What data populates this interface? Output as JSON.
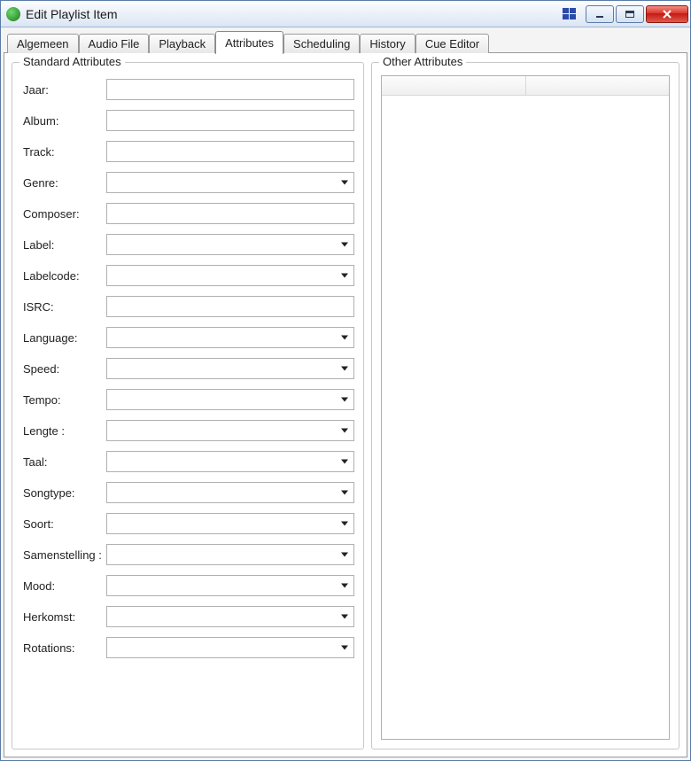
{
  "window": {
    "title": "Edit Playlist Item"
  },
  "tabs": [
    {
      "label": "Algemeen",
      "active": false
    },
    {
      "label": "Audio File",
      "active": false
    },
    {
      "label": "Playback",
      "active": false
    },
    {
      "label": "Attributes",
      "active": true
    },
    {
      "label": "Scheduling",
      "active": false
    },
    {
      "label": "History",
      "active": false
    },
    {
      "label": "Cue Editor",
      "active": false
    }
  ],
  "groups": {
    "standard": {
      "title": "Standard Attributes"
    },
    "other": {
      "title": "Other Attributes"
    }
  },
  "fields": [
    {
      "key": "jaar",
      "label": "Jaar:",
      "type": "text",
      "value": ""
    },
    {
      "key": "album",
      "label": "Album:",
      "type": "text",
      "value": ""
    },
    {
      "key": "track",
      "label": "Track:",
      "type": "text",
      "value": ""
    },
    {
      "key": "genre",
      "label": "Genre:",
      "type": "combo",
      "value": ""
    },
    {
      "key": "composer",
      "label": "Composer:",
      "type": "text",
      "value": ""
    },
    {
      "key": "label",
      "label": "Label:",
      "type": "combo",
      "value": ""
    },
    {
      "key": "labelcode",
      "label": "Labelcode:",
      "type": "combo",
      "value": ""
    },
    {
      "key": "isrc",
      "label": "ISRC:",
      "type": "text",
      "value": ""
    },
    {
      "key": "language",
      "label": "Language:",
      "type": "combo",
      "value": ""
    },
    {
      "key": "speed",
      "label": "Speed:",
      "type": "combo",
      "value": ""
    },
    {
      "key": "tempo",
      "label": "Tempo:",
      "type": "combo",
      "value": ""
    },
    {
      "key": "lengte",
      "label": "Lengte :",
      "type": "combo",
      "value": ""
    },
    {
      "key": "taal",
      "label": "Taal:",
      "type": "combo",
      "value": ""
    },
    {
      "key": "songtype",
      "label": "Songtype:",
      "type": "combo",
      "value": ""
    },
    {
      "key": "soort",
      "label": "Soort:",
      "type": "combo",
      "value": ""
    },
    {
      "key": "samenstelling",
      "label": "Samenstelling :",
      "type": "combo",
      "value": ""
    },
    {
      "key": "mood",
      "label": "Mood:",
      "type": "combo",
      "value": ""
    },
    {
      "key": "herkomst",
      "label": "Herkomst:",
      "type": "combo",
      "value": ""
    },
    {
      "key": "rotations",
      "label": "Rotations:",
      "type": "combo",
      "value": ""
    }
  ]
}
